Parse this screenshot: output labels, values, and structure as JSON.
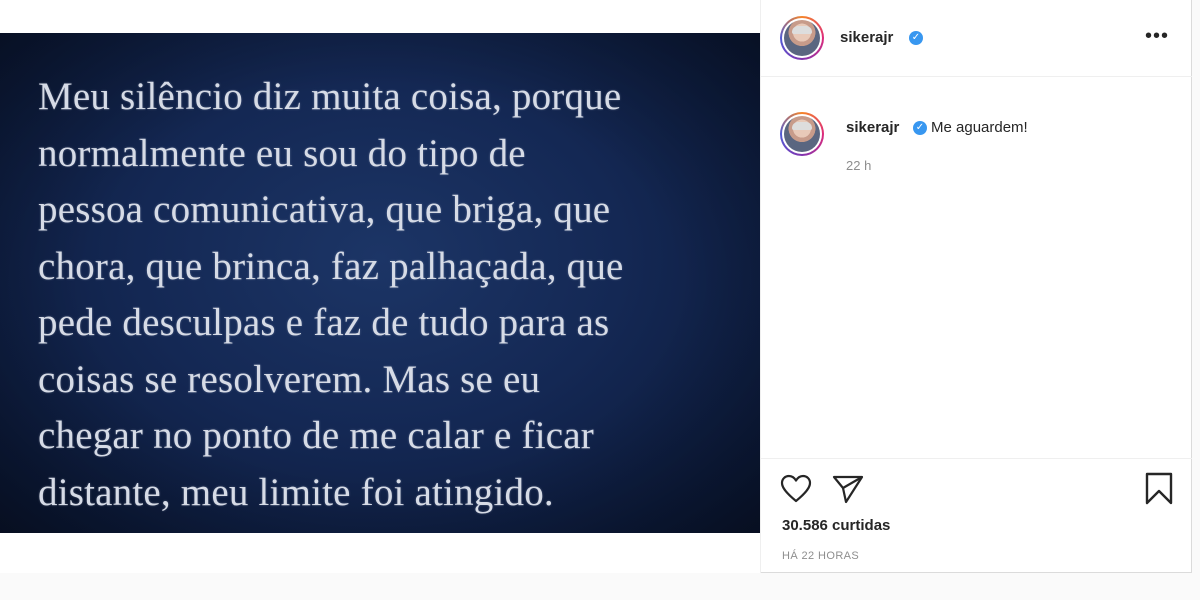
{
  "post": {
    "quote_text": "Meu silêncio diz muita coisa, porque\nnormalmente eu sou do tipo de\npessoa comunicativa, que briga, que\nchora, que brinca, faz palhaçada, que\npede desculpas e faz de tudo para as\ncoisas se resolverem. Mas se eu\nchegar no ponto de me calar e ficar\ndistante, meu limite foi atingido."
  },
  "header": {
    "username": "sikerajr",
    "verified_icon": "verified-badge-icon",
    "more_icon": "more-options-icon"
  },
  "caption": {
    "username": "sikerajr",
    "text": "Me aguardem!",
    "relative_time": "22 h"
  },
  "actions": {
    "like_icon": "heart-icon",
    "share_icon": "paper-plane-icon",
    "save_icon": "bookmark-icon",
    "likes_count": "30.586 curtidas",
    "timestamp": "HÁ 22 HORAS"
  },
  "colors": {
    "verified": "#3897f0",
    "text": "#262626",
    "muted": "#8e8e8e",
    "image_bg": "#142854"
  }
}
